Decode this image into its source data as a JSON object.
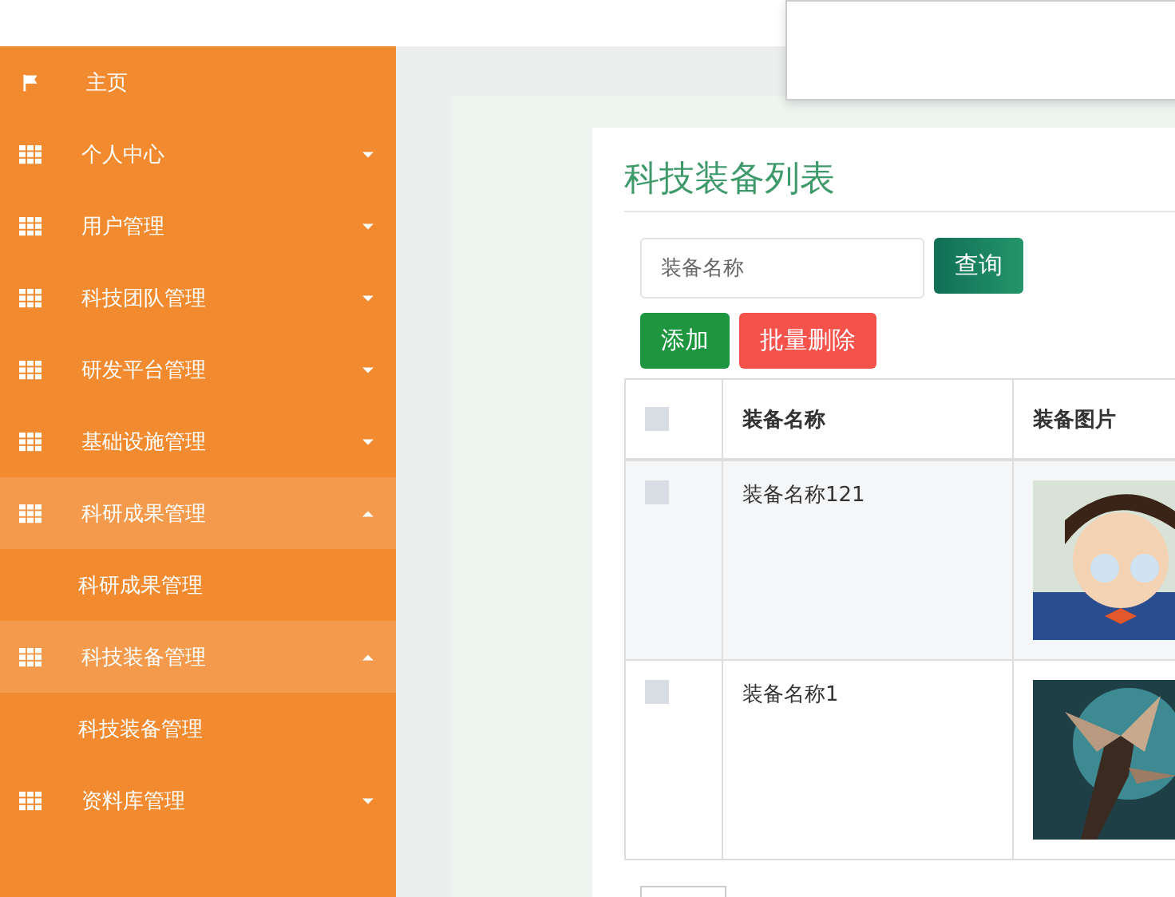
{
  "sidebar": {
    "items": [
      {
        "label": "主页",
        "kind": "link",
        "expanded": false
      },
      {
        "label": "个人中心",
        "kind": "menu",
        "expanded": false
      },
      {
        "label": "用户管理",
        "kind": "menu",
        "expanded": false
      },
      {
        "label": "科技团队管理",
        "kind": "menu",
        "expanded": false
      },
      {
        "label": "研发平台管理",
        "kind": "menu",
        "expanded": false
      },
      {
        "label": "基础设施管理",
        "kind": "menu",
        "expanded": false
      },
      {
        "label": "科研成果管理",
        "kind": "menu",
        "expanded": true,
        "children": [
          {
            "label": "科研成果管理"
          }
        ]
      },
      {
        "label": "科技装备管理",
        "kind": "menu",
        "expanded": true,
        "children": [
          {
            "label": "科技装备管理"
          }
        ]
      },
      {
        "label": "资料库管理",
        "kind": "menu",
        "expanded": false
      }
    ]
  },
  "page": {
    "title": "科技装备列表",
    "search": {
      "placeholder": "装备名称",
      "button": "查询"
    },
    "actions": {
      "add": "添加",
      "batch_delete": "批量删除"
    },
    "table": {
      "header_checked": false,
      "columns": [
        "装备名称",
        "装备图片"
      ],
      "rows": [
        {
          "checked": false,
          "name": "装备名称121"
        },
        {
          "checked": false,
          "name": "装备名称1"
        }
      ]
    }
  }
}
